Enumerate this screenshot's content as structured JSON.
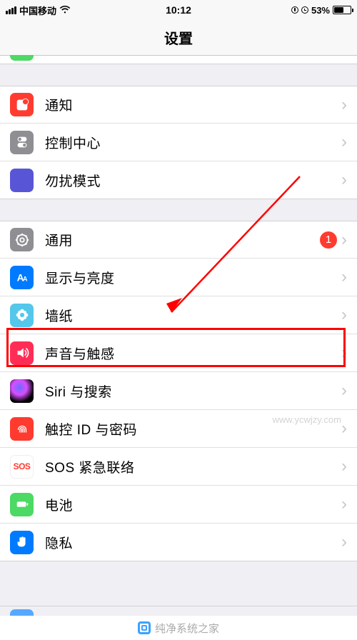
{
  "statusbar": {
    "carrier": "中国移动",
    "time": "10:12",
    "battery_pct": "53%"
  },
  "header": {
    "title": "设置"
  },
  "groups": [
    {
      "items": [
        {
          "key": "notifications",
          "label": "通知",
          "icon": "notifications-icon",
          "bg": "bg-red"
        },
        {
          "key": "control-center",
          "label": "控制中心",
          "icon": "control-center-icon",
          "bg": "bg-grey"
        },
        {
          "key": "dnd",
          "label": "勿扰模式",
          "icon": "moon-icon",
          "bg": "bg-purple"
        }
      ]
    },
    {
      "items": [
        {
          "key": "general",
          "label": "通用",
          "icon": "gear-icon",
          "bg": "bg-grey",
          "badge": "1"
        },
        {
          "key": "display",
          "label": "显示与亮度",
          "icon": "text-size-icon",
          "bg": "bg-blue"
        },
        {
          "key": "wallpaper",
          "label": "墙纸",
          "icon": "flower-icon",
          "bg": "bg-teal",
          "highlight": true
        },
        {
          "key": "sounds",
          "label": "声音与触感",
          "icon": "speaker-icon",
          "bg": "bg-pink"
        },
        {
          "key": "siri",
          "label": "Siri 与搜索",
          "icon": "siri-icon",
          "bg": "bg-dark"
        },
        {
          "key": "touchid",
          "label": "触控 ID 与密码",
          "icon": "fingerprint-icon",
          "bg": "bg-red"
        },
        {
          "key": "sos",
          "label": "SOS 紧急联络",
          "icon": "sos-icon",
          "bg": "bg-sos"
        },
        {
          "key": "battery",
          "label": "电池",
          "icon": "battery-icon",
          "bg": "bg-green"
        },
        {
          "key": "privacy",
          "label": "隐私",
          "icon": "hand-icon",
          "bg": "bg-blue"
        }
      ]
    }
  ],
  "watermarks": {
    "side": "www.ycwjzy.com",
    "footer": "纯净系统之家"
  }
}
